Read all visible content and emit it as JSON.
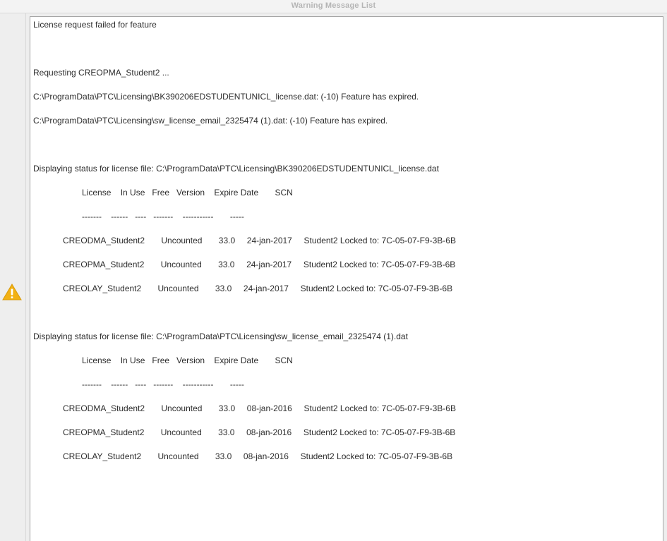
{
  "window": {
    "title": "Warning Message List"
  },
  "icons": {
    "warning": "warning-icon"
  },
  "colors": {
    "warning_fill": "#f2b114",
    "warning_mark": "#ffffff"
  },
  "messages": [
    "License request failed for feature",
    "Requesting CREOPMA_Student2 ...",
    "C:\\ProgramData\\PTC\\Licensing\\BK390206EDSTUDENTUNICL_license.dat: (-10) Feature has expired.",
    "C:\\ProgramData\\PTC\\Licensing\\sw_license_email_2325474 (1).dat: (-10) Feature has expired.",
    "Displaying status for license file: C:\\ProgramData\\PTC\\Licensing\\BK390206EDSTUDENTUNICL_license.dat",
    "License    In Use   Free   Version    Expire Date       SCN",
    "-------    ------   ----   -------    -----------       -----",
    "CREODMA_Student2       Uncounted       33.0     24-jan-2017     Student2 Locked to: 7C-05-07-F9-3B-6B",
    "CREOPMA_Student2       Uncounted       33.0     24-jan-2017     Student2 Locked to: 7C-05-07-F9-3B-6B",
    "CREOLAY_Student2       Uncounted       33.0     24-jan-2017     Student2 Locked to: 7C-05-07-F9-3B-6B",
    "Displaying status for license file: C:\\ProgramData\\PTC\\Licensing\\sw_license_email_2325474 (1).dat",
    "License    In Use   Free   Version    Expire Date       SCN",
    "-------    ------   ----   -------    -----------       -----",
    "CREODMA_Student2       Uncounted       33.0     08-jan-2016     Student2 Locked to: 7C-05-07-F9-3B-6B",
    "CREOPMA_Student2       Uncounted       33.0     08-jan-2016     Student2 Locked to: 7C-05-07-F9-3B-6B",
    "CREOLAY_Student2       Uncounted       33.0     08-jan-2016     Student2 Locked to: 7C-05-07-F9-3B-6B"
  ]
}
